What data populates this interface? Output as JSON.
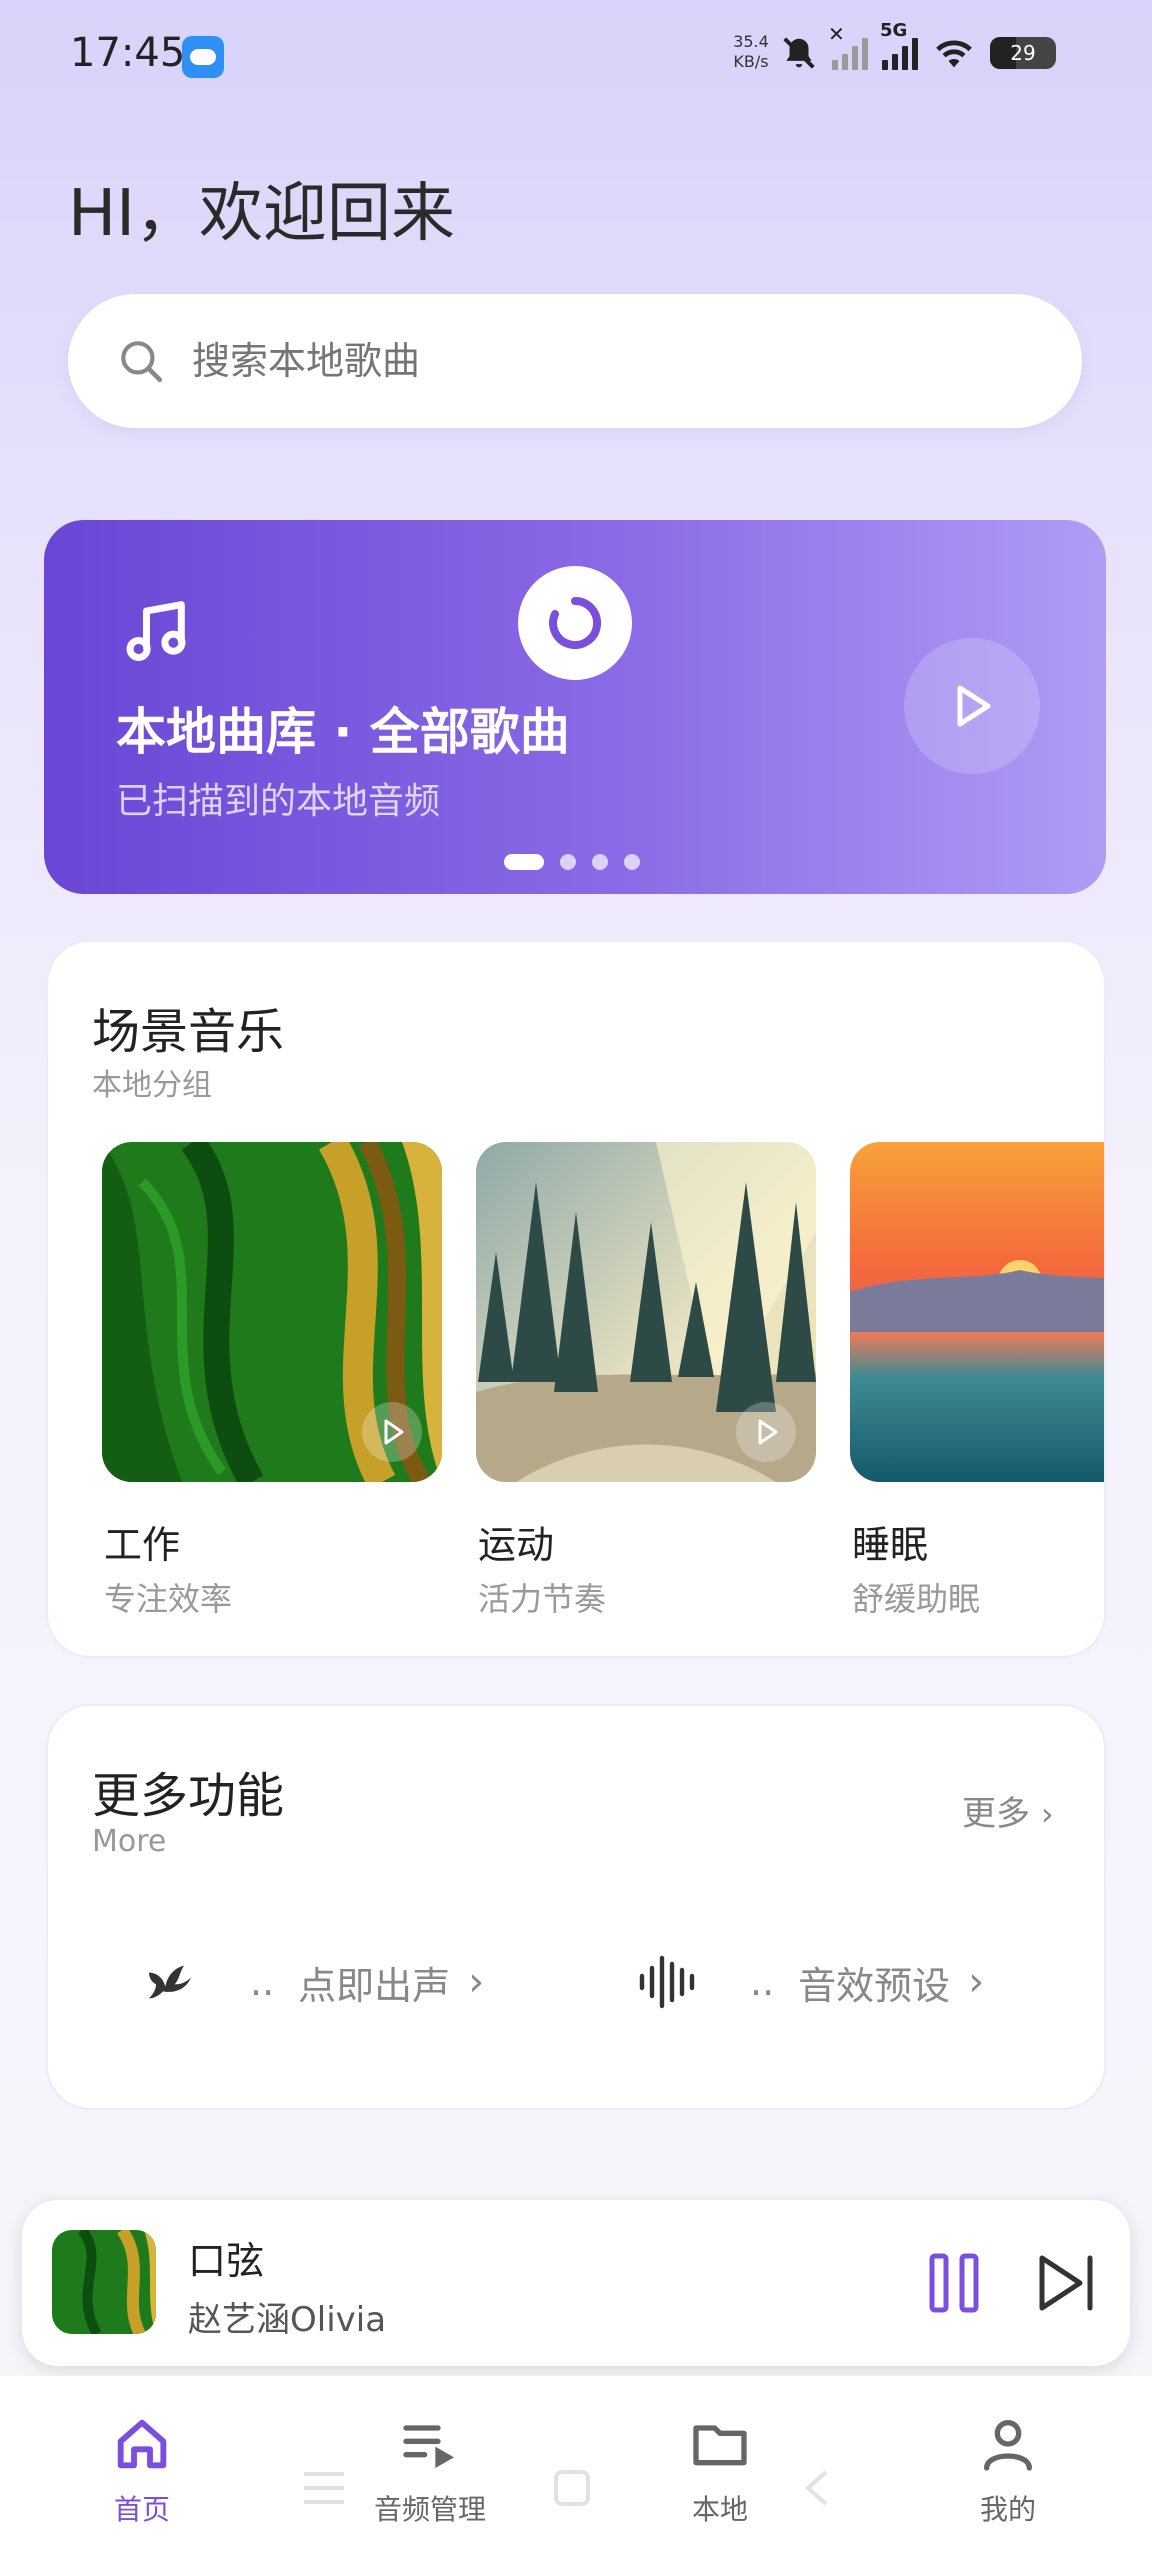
{
  "status_bar": {
    "time": "17:45",
    "speed_value": "35.4",
    "speed_unit": "KB/s",
    "network": "5G",
    "battery": "29"
  },
  "header": {
    "greeting": "HI，欢迎回来"
  },
  "search": {
    "placeholder": "搜索本地歌曲"
  },
  "banner": {
    "title": "本地曲库 · 全部歌曲",
    "subtitle": "已扫描到的本地音频",
    "page_count": 4,
    "active_page": 1,
    "gradient": [
      "#6a46d6",
      "#b09cf5"
    ]
  },
  "scene_music": {
    "title": "场景音乐",
    "subtitle": "本地分组",
    "items": [
      {
        "name": "工作",
        "desc": "专注效率"
      },
      {
        "name": "运动",
        "desc": "活力节奏"
      },
      {
        "name": "睡眠",
        "desc": "舒缓助眠"
      }
    ]
  },
  "more_functions": {
    "title": "更多功能",
    "subtitle": "More",
    "more_label": "更多",
    "items": [
      {
        "prefix": "..",
        "label": "点即出声",
        "icon": "bird-icon"
      },
      {
        "prefix": "..",
        "label": "音效预设",
        "icon": "sound-wave-icon"
      }
    ]
  },
  "mini_player": {
    "title": "口弦",
    "artist": "赵艺涵Olivia",
    "state": "playing"
  },
  "bottom_nav": {
    "items": [
      {
        "label": "首页",
        "icon": "home-icon",
        "active": true
      },
      {
        "label": "音频管理",
        "icon": "playlist-icon",
        "active": false
      },
      {
        "label": "本地",
        "icon": "folder-icon",
        "active": false
      },
      {
        "label": "我的",
        "icon": "profile-icon",
        "active": false
      }
    ]
  },
  "colors": {
    "accent": "#7a4fe0"
  }
}
